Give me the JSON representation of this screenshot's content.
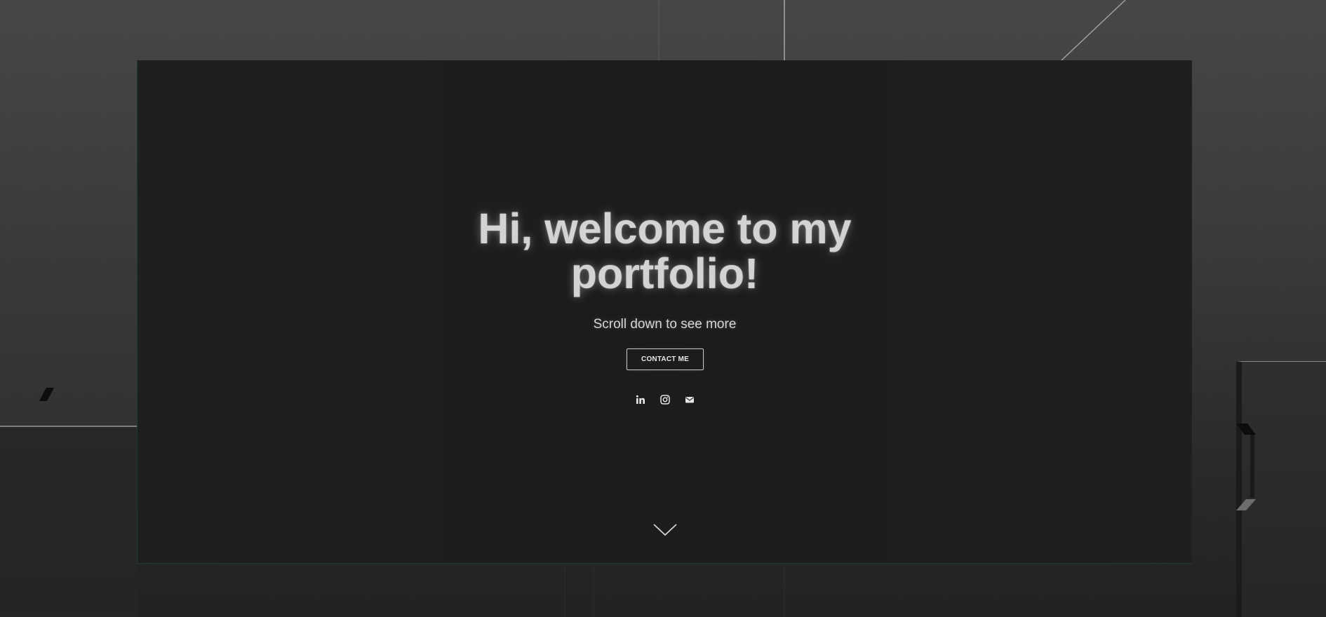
{
  "hero": {
    "title_line1": "Hi, welcome to my",
    "title_line2": "portfolio!",
    "subtitle": "Scroll down to see more",
    "contact_button_label": "CONTACT ME"
  },
  "social": {
    "icons": [
      "linkedin-icon",
      "instagram-icon",
      "email-icon"
    ]
  },
  "scroll_indicator": {
    "icon": "chevron-down-icon"
  },
  "colors": {
    "page_background": "#474747",
    "card_background": "#1e1e1e",
    "card_edge_accent": "#1d3b3c",
    "text": "#d3d3d3",
    "button_border": "#c9c9c9"
  }
}
